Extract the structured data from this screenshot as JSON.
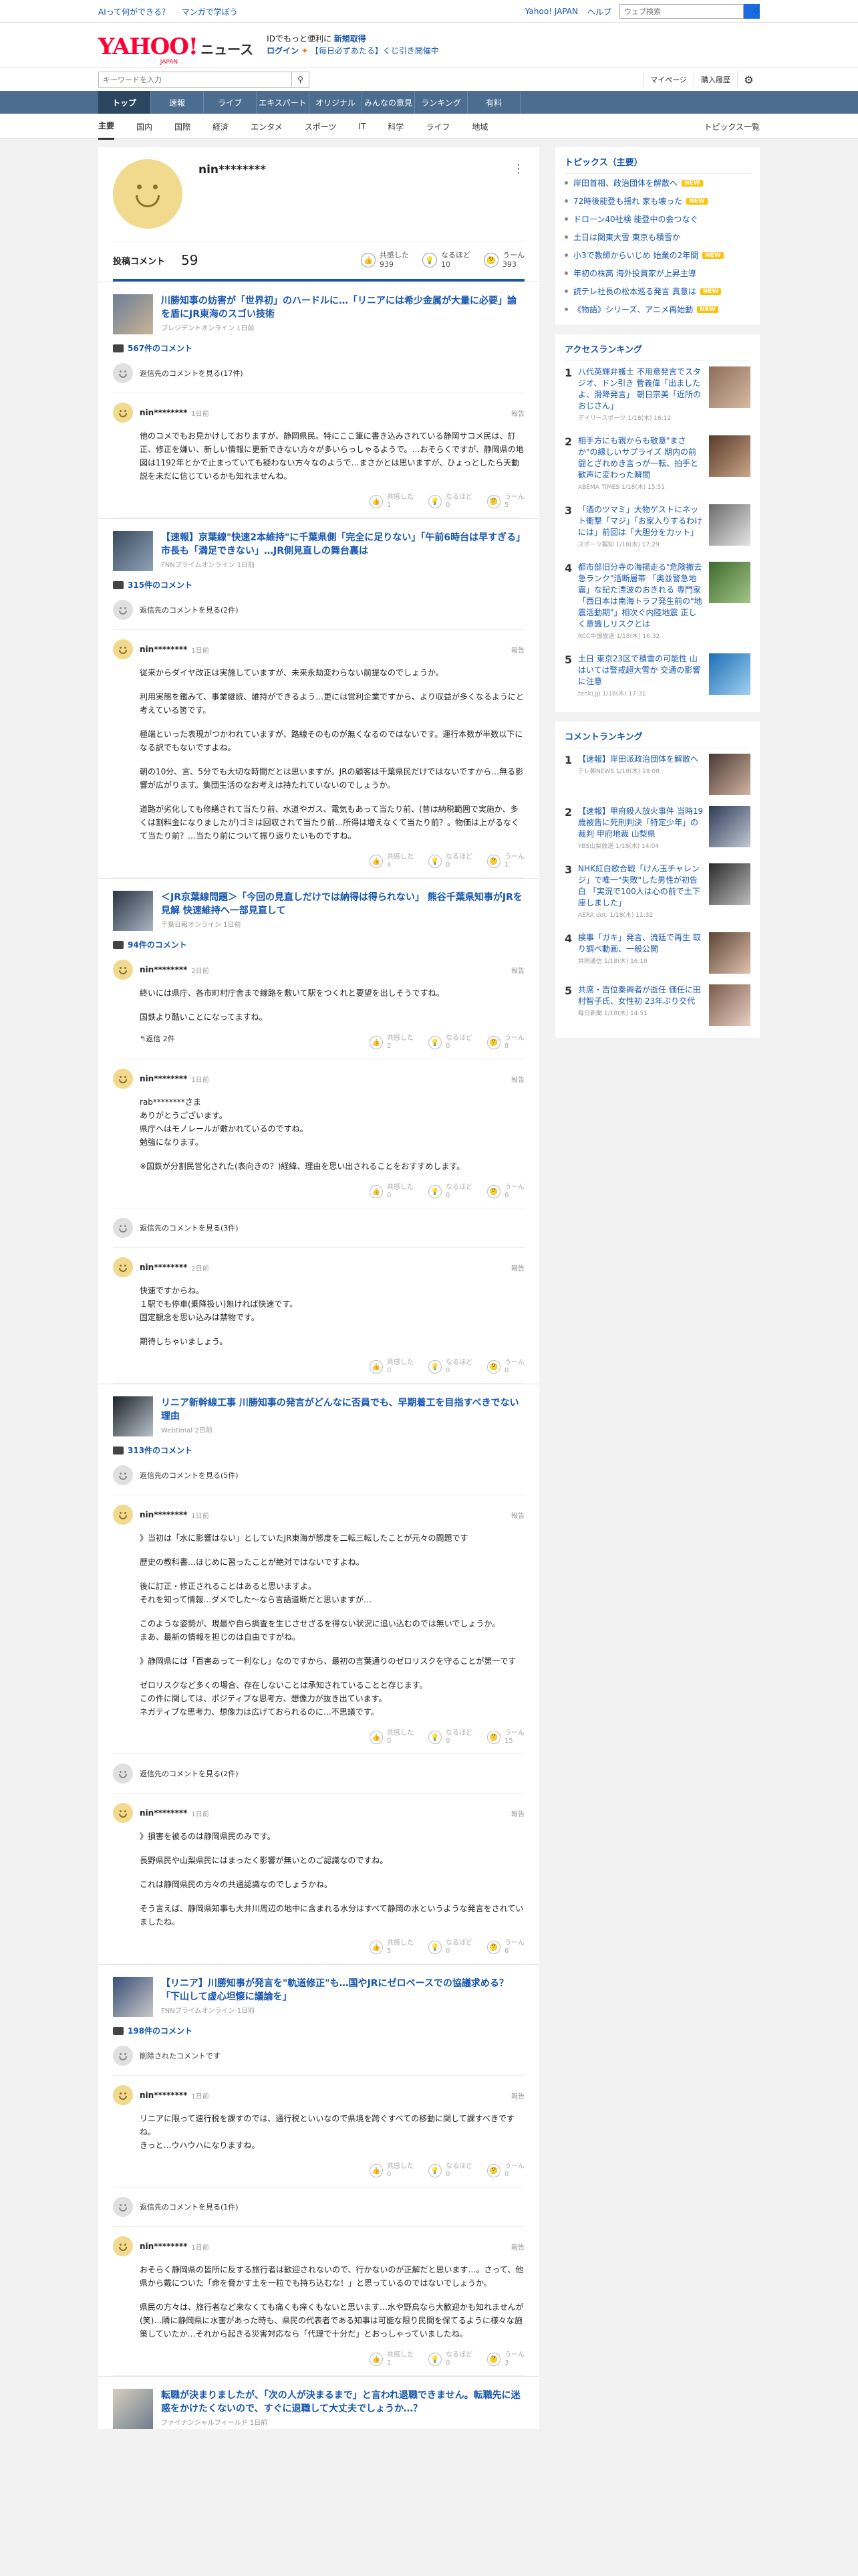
{
  "topbar": {
    "link1": "AIって何ができる？",
    "link2": "マンガで学ぼう",
    "yahoo_japan": "Yahoo! JAPAN",
    "help": "ヘルプ",
    "search_placeholder": "ウェブ検索"
  },
  "header": {
    "logo_yahoo": "YAHOO!",
    "logo_japan": "JAPAN",
    "logo_news": "ニュース",
    "promo_line1_a": "IDでもっと便利に",
    "promo_line1_b": "新規取得",
    "promo_login": "ログイン",
    "promo_line2": "【毎日必ずあたる】くじ引き開催中"
  },
  "search": {
    "placeholder": "キーワードを入力",
    "mypage": "マイページ",
    "purchased": "購入履歴"
  },
  "nav": [
    "トップ",
    "速報",
    "ライブ",
    "エキスパート",
    "オリジナル",
    "みんなの意見",
    "ランキング",
    "有料"
  ],
  "subnav": [
    "主要",
    "国内",
    "国際",
    "経済",
    "エンタメ",
    "スポーツ",
    "IT",
    "科学",
    "ライフ",
    "地域"
  ],
  "subnav_right": "トピックス一覧",
  "profile": {
    "name": "nin********",
    "post_label": "投稿コメント",
    "post_count": "59",
    "r1_label": "共感した",
    "r1_count": "939",
    "r2_label": "なるほど",
    "r2_count": "10",
    "r3_label": "うーん",
    "r3_count": "393"
  },
  "articles": [
    {
      "title": "川勝知事の妨害が「世界初」のハードルに…「リニアには希少金属が大量に必要」論を盾にJR東海のスゴい技術",
      "source": "プレジデントオンライン 1日前",
      "count": "567件のコメント",
      "prev": "返信先のコメントを見る(17件)",
      "comments": [
        {
          "name": "nin********",
          "time": "1日前",
          "report": "報告",
          "paras": [
            "他のコメでもお見かけしておりますが、静岡県民。特にここ筆に書き込みされている静岡サコメ民は、訂正、修正を嫌い、新しい情報に更新できない方々が多いらっしゃるようで。…おそらくですが、静岡県の地図は1192年とかで止まっていても疑わない方々なのようで…まさかとは思いますが、ひょっとしたら天動説を未だに信じているかも知れませんね。"
          ],
          "a1": "共感した",
          "n1": "1",
          "a2": "なるほど",
          "n2": "0",
          "a3": "うーん",
          "n3": "5"
        }
      ]
    },
    {
      "title": "【速報】京葉線\"快速2本維持\"に千葉県側「完全に足りない」「午前6時台は早すぎる」市長も「満足できない」…JR側見直しの舞台裏は",
      "source": "FNNプライムオンライン 1日前",
      "count": "315件のコメント",
      "prev": "返信先のコメントを見る(2件)",
      "comments": [
        {
          "name": "nin********",
          "time": "1日前",
          "report": "報告",
          "paras": [
            "従来からダイヤ改正は実施していますが、未来永劫変わらない前提なのでしょうか。",
            "利用実態を鑑みて、事業継続、維持ができるよう…更には営利企業ですから、より収益が多くなるようにと考えている筈です。",
            "極端といった表現がつかわれていますが、路線そのものが無くなるのではないです。運行本数が半数以下になる訳でもないですよね。",
            "朝の10分、言、5分でも大切な時間だとは思いますが。JRの顧客は千葉県民だけではないですから…無る影響が広がります。集団生活のなお考えは持たれていないのでしょうか。",
            "道路が劣化しても修繕されて当たり前、水道やガス、電気もあって当たり前、(昔は納税範囲で実施か、多くは割料金になりましたが)ゴミは回収されて当たり前…所得は増えなくて当たり前？。物価は上がるなくて当たり前？…当たり前について振り返りたいものですね。"
          ],
          "a1": "共感した",
          "n1": "4",
          "a2": "なるほど",
          "n2": "0",
          "a3": "うーん",
          "n3": "1"
        }
      ]
    },
    {
      "title": "＜JR京葉線問題＞「今回の見直しだけでは納得は得られない」 熊谷千葉県知事がJRを見解 快速維持へ一部見直して",
      "source": "千葉日報オンライン 1日前",
      "count": "94件のコメント",
      "comments": [
        {
          "name": "nin********",
          "time": "2日前",
          "report": "報告",
          "paras": [
            "終いには県庁、各市町村庁舎まで線路を敷いて駅をつくれと要望を出しそうですね。",
            "国鉄より酷いことになってますね。"
          ],
          "reply": "返信 2件",
          "a1": "共感した",
          "n1": "2",
          "a2": "なるほど",
          "n2": "0",
          "a3": "うーん",
          "n3": "8"
        },
        {
          "name": "nin********",
          "time": "1日前",
          "report": "報告",
          "paras": [
            "rab********さま\nありがとうございます。\n県庁へはモノレールが敷かれているのですね。\n勉強になります。",
            "※国鉄が分割民営化された(表向きの？)経緯、理由を思い出されることをおすすめします。"
          ],
          "a1": "共感した",
          "n1": "0",
          "a2": "なるほど",
          "n2": "0",
          "a3": "うーん",
          "n3": "0"
        }
      ],
      "prev2": "返信先のコメントを見る(3件)",
      "comments2": [
        {
          "name": "nin********",
          "time": "2日前",
          "report": "報告",
          "paras": [
            "快速ですからね。\n１駅でも停車(乗降扱い)無ければ快速です。\n固定観念を思い込みは禁物です。",
            "期待しちゃいましょう。"
          ],
          "a1": "共感した",
          "n1": "0",
          "a2": "なるほど",
          "n2": "0",
          "a3": "うーん",
          "n3": "0"
        }
      ]
    },
    {
      "title": "リニア新幹線工事 川勝知事の発言がどんなに否員でも、早期着工を目指すべきでない理由",
      "source": "Webtimal 2日前",
      "count": "313件のコメント",
      "prev": "返信先のコメントを見る(5件)",
      "comments": [
        {
          "name": "nin********",
          "time": "1日前",
          "report": "報告",
          "paras": [
            "》当初は「水に影響はない」としていたJR東海が態度を二転三転したことが元々の問題です",
            "歴史の教科書…ほじめに習ったことが絶対ではないですよね。",
            "後に訂正・修正されることはあると思いますよ。\nそれを知って情報…ダメでした～なら言語道断だと思いますが…",
            "このような姿勢が、現最や自ら調査を生じさせざるを得ない状況に追い込むのでは無いでしょうか。\nまあ、最新の情報を担じのは自由ですがね。",
            "》静岡県には「百害あって一利なし」なのですから、最初の言葉通りのゼロリスクを守ることが第一です",
            "ゼロリスクなど多くの場合、存在しないことは承知されていることと存じます。\nこの件に関しては、ポジティブな思考方、想像力が抜き出ています。\nネガティブな思考力、想像力は広げておられるのに…不思議です。"
          ],
          "a1": "共感した",
          "n1": "0",
          "a2": "なるほど",
          "n2": "0",
          "a3": "うーん",
          "n3": "15"
        }
      ],
      "prev2": "返信先のコメントを見る(2件)",
      "comments2": [
        {
          "name": "nin********",
          "time": "1日前",
          "report": "報告",
          "paras": [
            "》損害を被るのは静岡県民のみです。",
            "長野県民や山梨県民にはまったく影響が無いとのご認識なのですね。",
            "これは静岡県民の方々の共通認識なのでしょうかね。",
            "そう言えば、静岡県知事も大井川周辺の地中に含まれる水分はすべて静岡の水というような発言をされていましたね。"
          ],
          "a1": "共感した",
          "n1": "5",
          "a2": "なるほど",
          "n2": "0",
          "a3": "うーん",
          "n3": "6"
        }
      ]
    },
    {
      "title": "【リニア】川勝知事が発言を\"軌道修正\"も…国やJRにゼロベースでの協議求める？「下山して虚心坦懐に議論を」",
      "source": "FNNプライムオンライン 1日前",
      "count": "198件のコメント",
      "prev": "削除されたコメントです",
      "comments": [
        {
          "name": "nin********",
          "time": "1日前",
          "report": "報告",
          "paras": [
            "リニアに限って速行税を課すのでは、通行税といいなので県境を跨ぐすべての移動に関して課すべきですね。\nきっと…ウハウハになりますね。"
          ],
          "a1": "共感した",
          "n1": "0",
          "a2": "なるほど",
          "n2": "0",
          "a3": "うーん",
          "n3": "0"
        }
      ],
      "prev2": "返信先のコメントを見る(1件)",
      "comments2": [
        {
          "name": "nin********",
          "time": "1日前",
          "report": "報告",
          "paras": [
            "おそらく静岡県の皆所に反する旅行者は歓迎されないので、行かないのが正解だと思います…。さって、他県から戴についた「命を脅かす土を一粒でも持ち込むな！」と思っているのではないでしょうか。",
            "県民の方々は、旅行者など来なくても痛くも痒くもないと思います…水や野鳥なら大歓迎かも知れませんが(笑)…隣に静岡県に水害があった時も、県民の代表者である知事は可能な限り民間を保てるように様々な施策していたか…それから起きる災害対応なら「代理で十分だ」とおっしゃっていましたね。"
          ],
          "a1": "共感した",
          "n1": "1",
          "a2": "なるほど",
          "n2": "0",
          "a3": "うーん",
          "n3": "3"
        }
      ]
    },
    {
      "title": "転職が決まりましたが、「次の人が決まるまで」と言われ退職できません。転職先に迷惑をかけたくないので、すぐに退職して大丈夫でしょうか…？",
      "source": "ファイナンシャルフィールド 1日前",
      "count": "",
      "comments": []
    }
  ],
  "sidebar": {
    "topics_title": "トピックス（主要）",
    "topics": [
      {
        "text": "岸田首相、政治団体を解散へ",
        "badge": "NEW"
      },
      {
        "text": "72時後能登も揺れ 家も壊った",
        "badge": "NEW"
      },
      {
        "text": "ドローン40社検 能登中の会つなぐ",
        "badge": ""
      },
      {
        "text": "土日は関東大雪 東京も積雪か",
        "badge": ""
      },
      {
        "text": "小3で教師からいじめ 始業の2年間",
        "badge": "NEW"
      },
      {
        "text": "年初の株高 海外投資家が上昇主導",
        "badge": ""
      },
      {
        "text": "読テレ社長の松本巡る発言 真意は",
        "badge": "NEW"
      },
      {
        "text": "《物語》シリーズ、アニメ再始動",
        "badge": "NEW"
      }
    ],
    "access_title": "アクセスランキング",
    "access": [
      {
        "no": "1",
        "text": "八代英輝弁護士 不用意発言でスタジオ、ドン引き 菅義偉「出ましたよ、滑降発言」 朝日宗美「近所のおじさん」",
        "meta": "デイリースポーツ 1/18(木) 16:12"
      },
      {
        "no": "2",
        "text": "相手方にも親からも敬意\"まさか\"の縁しいサプライズ 期内の前闘とざれめき言っが一転、拍手と歓声に変わった瞬間",
        "meta": "ABEMA TIMES 1/18(木) 15:51"
      },
      {
        "no": "3",
        "text": "「酒のツマミ」大物ゲストにネット衝撃「マジ」「お家入りするわけには」前回は「大胆分を力ット」",
        "meta": "スポーツ報知 1/18(木) 17:29"
      },
      {
        "no": "4",
        "text": "都市部旧分寺の海揚走る\"危険撤去急ランク\"活断層帯 「奥並警急地震」な記た漂波のおきれる 専門家「西日本は南海トラフ発生前の\"地震活動期\"」相次ぐ内陸地震 正しく意識しリスクとは",
        "meta": "RCC中国放送 1/18(木) 16:32"
      },
      {
        "no": "5",
        "text": "土日 東京23区で積雪の可能性 山はいては警戒超大雪か 交通の影響に注意",
        "meta": "tenki.jp 1/18(木) 17:31"
      }
    ],
    "comment_title": "コメントランキング",
    "comment_rank": [
      {
        "no": "1",
        "text": "【速報】岸田派政治団体を解散へ",
        "meta": "テレ朝NEWS 1/18(木) 19:08"
      },
      {
        "no": "2",
        "text": "【速報】甲府殺人放火事件 当時19歳被告に死刑判決「特定少年」の裁判 甲府地裁 山梨県",
        "meta": "YBS山梨放送 1/18(木) 14:04"
      },
      {
        "no": "3",
        "text": "NHK紅白歌合戦「けん玉チャレンジ」で唯一\"失敗\"した男性が初告白 「実況で100人は心の前で土下座しました」",
        "meta": "AERA dot. 1/18(木) 11:32"
      },
      {
        "no": "4",
        "text": "検事「ガキ」発言、流廷で再生 取り調べ動画、一般公開",
        "meta": "共同通信 1/18(木) 16:10"
      },
      {
        "no": "5",
        "text": "共席・吉位秦興者が逝任 価任に田村智子氏、女性初 23年ぶり交代",
        "meta": "毎日新聞 1/18(木) 14:51"
      }
    ]
  }
}
